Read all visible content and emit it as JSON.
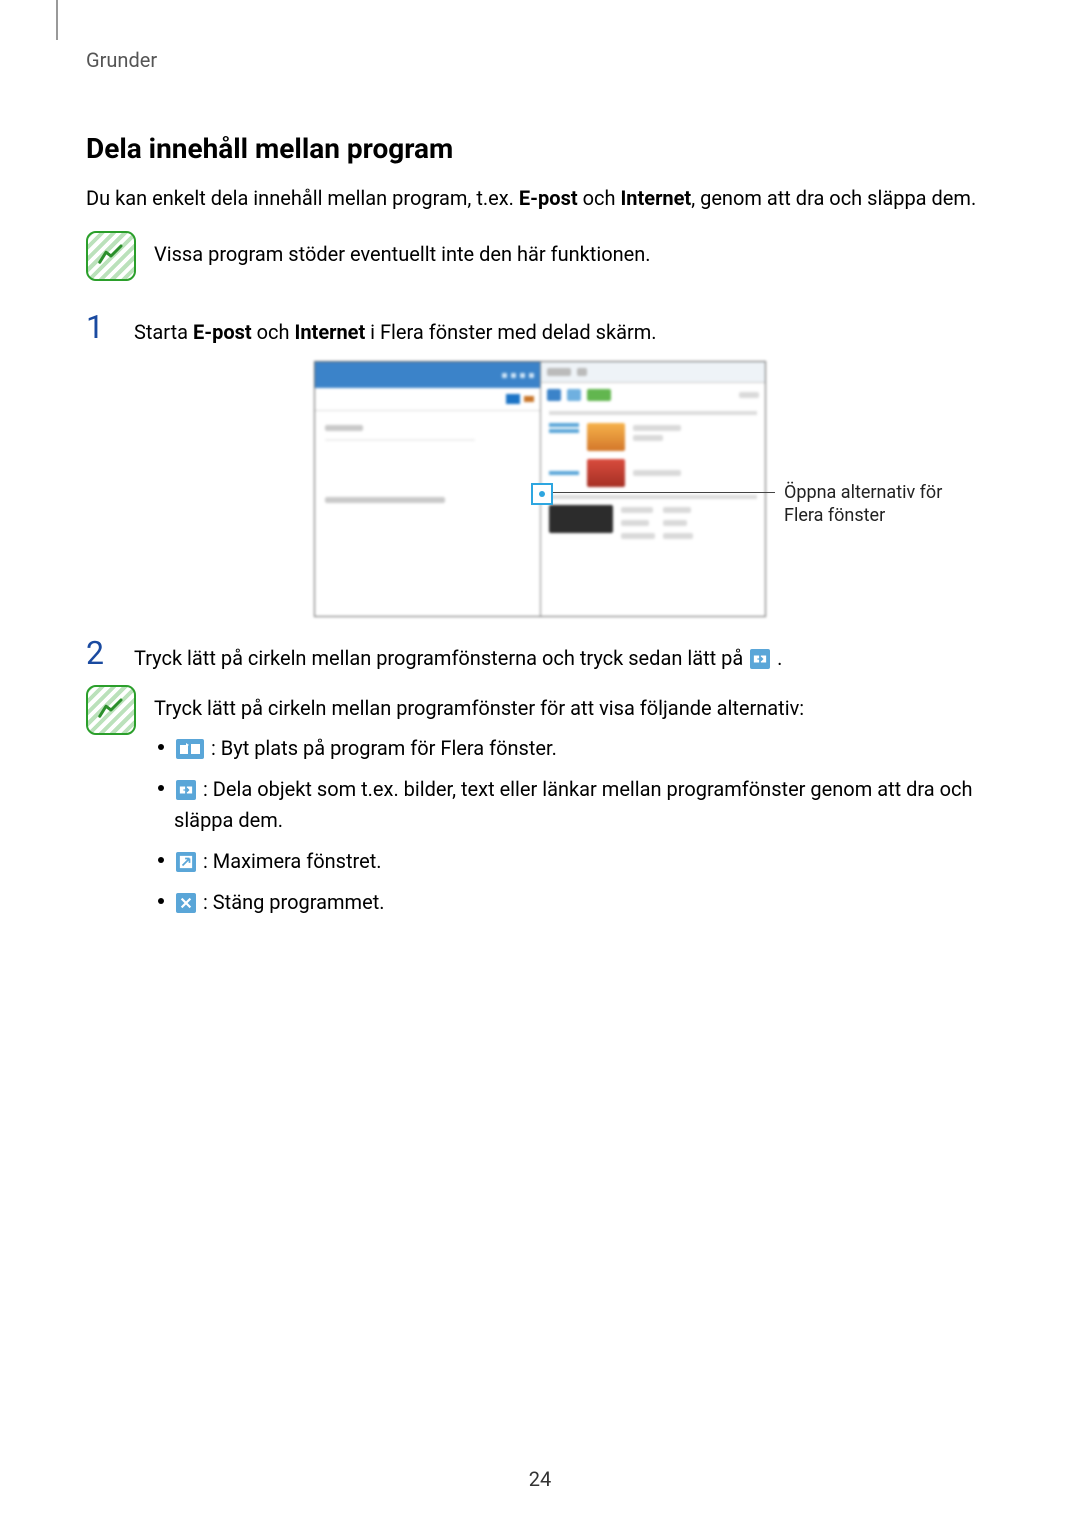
{
  "breadcrumb": "Grunder",
  "heading": "Dela innehåll mellan program",
  "intro": {
    "pre": "Du kan enkelt dela innehåll mellan program, t.ex. ",
    "bold1": "E-post",
    "mid1": " och ",
    "bold2": "Internet",
    "post": ", genom att dra och släppa dem."
  },
  "note1": "Vissa program stöder eventuellt inte den här funktionen.",
  "step1": {
    "num": "1",
    "pre": "Starta ",
    "bold1": "E-post",
    "mid1": " och ",
    "bold2": "Internet",
    "post": " i Flera fönster med delad skärm."
  },
  "callout": "Öppna alternativ för Flera fönster",
  "step2": {
    "num": "2",
    "pre": "Tryck lätt på cirkeln mellan programfönsterna och tryck sedan lätt på ",
    "post": "."
  },
  "note2_intro": "Tryck lätt på cirkeln mellan programfönster för att visa följande alternativ:",
  "opts": {
    "a": " : Byt plats på program för Flera fönster.",
    "b": " : Dela objekt som t.ex. bilder, text eller länkar mellan programfönster genom att dra och släppa dem.",
    "c": " : Maximera fönstret.",
    "d": " : Stäng programmet."
  },
  "page": "24"
}
